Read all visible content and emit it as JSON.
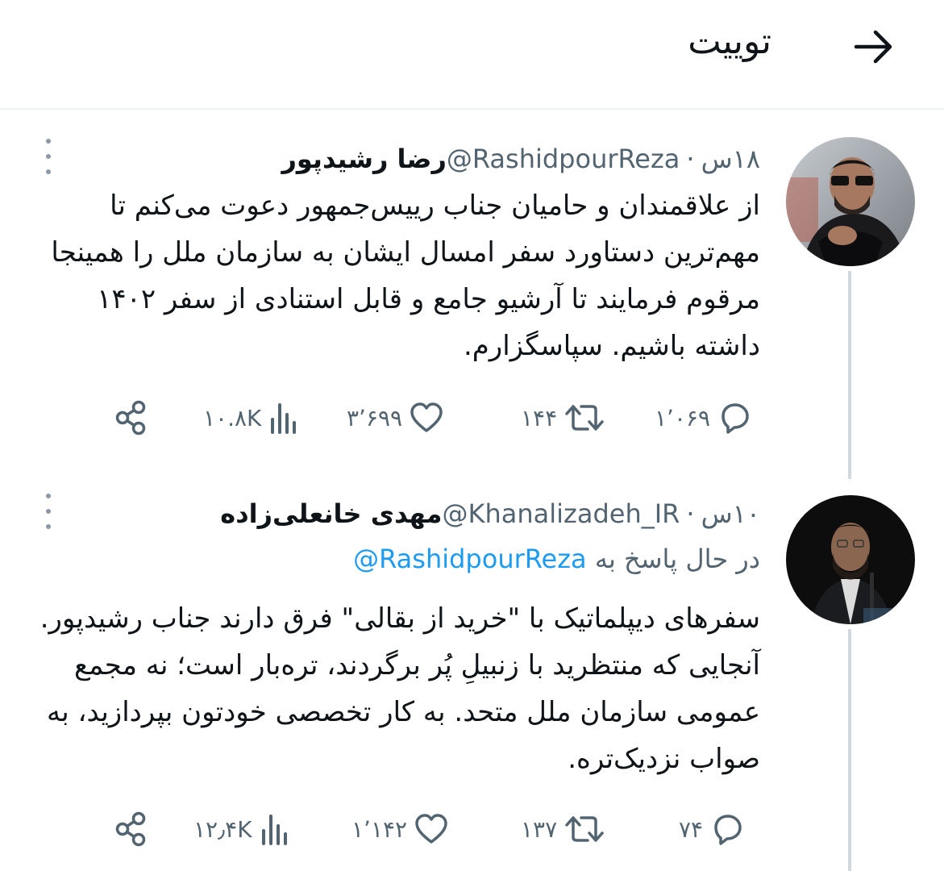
{
  "header": {
    "title": "توییت",
    "back_icon": "arrow-right-icon"
  },
  "tweets": [
    {
      "name": "رضا رشیدپور",
      "handle": "@RashidpourReza",
      "separator": "·",
      "time": "۱۸س",
      "text": "از علاقمندان و حامیان جناب رییس‌جمهور دعوت می‌کنم تا مهم‌ترین دستاورد سفر امسال ایشان به سازمان ملل را همینجا مرقوم فرمایند تا آرشیو جامع و قابل استنادی از سفر ۱۴۰۲ داشته باشیم. سپاسگزارم.",
      "stats": {
        "replies": "۱٬۰۶۹",
        "retweets": "۱۴۴",
        "likes": "۳٬۶۹۹",
        "views": "۱۰.۸K"
      }
    },
    {
      "name": "مهدی خانعلی‌زاده",
      "handle": "@Khanalizadeh_IR",
      "separator": "·",
      "time": "۱۰س",
      "reply_prefix": "در حال پاسخ به",
      "reply_mention": "@RashidpourReza",
      "text": "سفرهای دیپلماتیک با \"خرید از بقالی\" فرق دارند جناب رشیدپور. آنجایی که منتظرید با زنبیلِ پُر برگردند، تره‌بار است؛ نه مجمع عمومی سازمان ملل متحد. به کار تخصصی خودتون بپردازید، به صواب نزدیک‌تره.",
      "stats": {
        "replies": "۷۴",
        "retweets": "۱۳۷",
        "likes": "۱٬۱۴۲",
        "views": "۱۲٫۴K"
      }
    }
  ],
  "colors": {
    "text": "#0f1419",
    "secondary": "#536471",
    "link": "#1d9bf0",
    "divider": "#eff3f4",
    "thread": "#cfd9de"
  }
}
